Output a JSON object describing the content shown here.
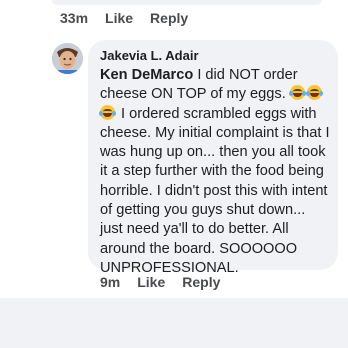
{
  "previous_comment": {
    "time": "33m",
    "like_label": "Like",
    "reply_label": "Reply"
  },
  "comment": {
    "author": "Jakevia L. Adair",
    "mention": "Ken DeMarco",
    "text_part1": " I did NOT order cheese ON TOP of my eggs. ",
    "text_part2": " I ordered scrambled eggs with cheese. My initial complaint is that I was hung up on... then you all took it a step further with the food being horrible. I didn't post this with intent of getting you guys shut down... just need ya'll to do better. All around the board. SOOOOOO UNPROFESSIONAL.",
    "emoji_name": "face-with-tears-of-joy-icon",
    "time": "9m",
    "like_label": "Like",
    "reply_label": "Reply"
  },
  "colors": {
    "bubble": "#f0f2f5",
    "text": "#1c1e21",
    "meta": "#4a4b4d",
    "emoji": "#f7c531"
  }
}
